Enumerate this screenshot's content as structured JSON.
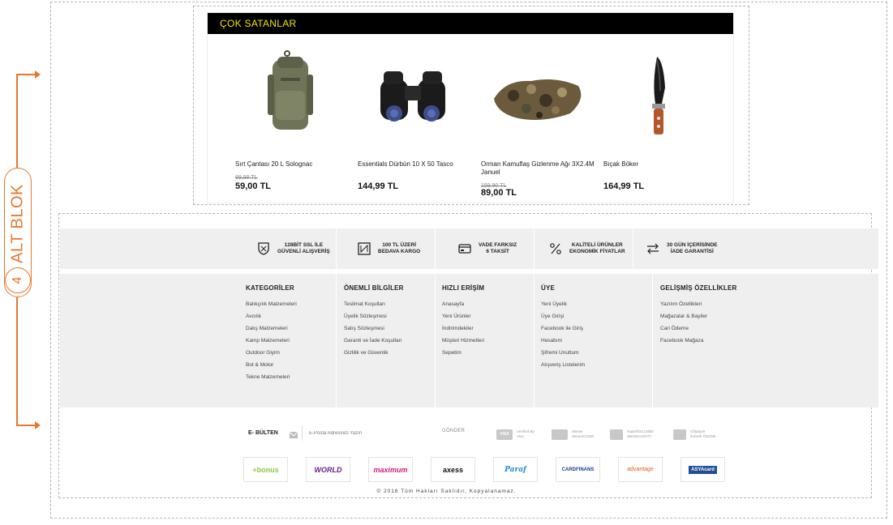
{
  "annotation": {
    "label": "ALT BLOK",
    "number": "4",
    "color": "#e8772e"
  },
  "best_sellers": {
    "title": "ÇOK SATANLAR",
    "products": [
      {
        "name": "Sırt Çantası 20 L Solognac",
        "old_price": "89,99 TL",
        "price": "59,00 TL",
        "icon": "backpack-icon"
      },
      {
        "name": "Essentials Dürbün 10 X 50 Tasco",
        "old_price": "",
        "price": "144,99 TL",
        "icon": "binoculars-icon"
      },
      {
        "name": "Orman Kamuflaş Gizlenme Ağı 3X2.4M Januel",
        "old_price": "159,90 TL",
        "price": "89,00 TL",
        "icon": "camouflage-net-icon"
      },
      {
        "name": "Bıçak Böker",
        "old_price": "",
        "price": "164,99 TL",
        "icon": "knife-icon"
      }
    ]
  },
  "features": [
    {
      "line1": "128BİT SSL İLE",
      "line2": "GÜVENLİ ALIŞVERİŞ",
      "icon": "shield-icon"
    },
    {
      "line1": "100 TL ÜZERİ",
      "line2": "BEDAVA KARGO",
      "icon": "box-icon"
    },
    {
      "line1": "VADE FARKSIZ",
      "line2": "6 TAKSİT",
      "icon": "credit-card-icon"
    },
    {
      "line1": "KALİTELİ ÜRÜNLER",
      "line2": "EKONOMİK FİYATLAR",
      "icon": "percent-icon"
    },
    {
      "line1": "30 GÜN İÇERİSİNDE",
      "line2": "İADE GARANTİSİ",
      "icon": "return-arrows-icon"
    }
  ],
  "footer_columns": [
    {
      "title": "KATEGORİLER",
      "items": [
        "Balıkçılık Malzemeleri",
        "Avcılık",
        "Dalış Malzemeleri",
        "Kamp Malzemeleri",
        "Outdoor Giyim",
        "Bot & Motor",
        "Tekne Malzemeleri"
      ]
    },
    {
      "title": "ÖNEMLİ BİLGİLER",
      "items": [
        "Teslimat Koşulları",
        "Üyelik Sözleşmesi",
        "Satış Sözleşmesi",
        "Garanti ve İade Koşulları",
        "Gizlilik ve Güvenlik"
      ]
    },
    {
      "title": "HIZLI ERİŞİM",
      "items": [
        "Anasayfa",
        "Yeni Ürünler",
        "İndirimdekiler",
        "Müşteri Hizmetleri",
        "Sepetim"
      ]
    },
    {
      "title": "ÜYE",
      "items": [
        "Yeni Üyelik",
        "Üye Girişi",
        "Facebook ile Giriş",
        "Hesabım",
        "Şifremi Unuttum",
        "Alışveriş Listelerim"
      ]
    },
    {
      "title": "GELİŞMİŞ ÖZELLİKLER",
      "items": [
        "Yazılım Özellikleri",
        "Mağazalar & Bayiler",
        "Cari Ödeme",
        "Facebook Mağaza"
      ]
    }
  ],
  "newsletter": {
    "label": "E- BÜLTEN",
    "placeholder": "E-Posta Adresinizi Yazın",
    "button": "GÖNDER"
  },
  "security_badges": [
    {
      "line1": "Verified By",
      "line2": "Visa",
      "icon_text": "VISA"
    },
    {
      "line1": "Master",
      "line2": "SecureCODE",
      "icon_text": ""
    },
    {
      "line1": "RapidSSL128bit",
      "line2": "SiteSECURITY",
      "icon_text": ""
    },
    {
      "line1": "Chip&pin",
      "line2": "lmzanlı ÖDEMe",
      "icon_text": ""
    }
  ],
  "banks": [
    {
      "label": "+bonus",
      "color": "#8dc63f"
    },
    {
      "label": "WORLD",
      "color": "#6a1b8a"
    },
    {
      "label": "maximum",
      "color": "#d6177c"
    },
    {
      "label": "axess",
      "color": "#111111"
    },
    {
      "label": "Paraf",
      "color": "#1e88c8"
    },
    {
      "label": "CARDFINANS",
      "color": "#1a3a8a"
    },
    {
      "label": "advantage",
      "color": "#e85a1b"
    },
    {
      "label": "ASYAcard",
      "color": "#1f4e96"
    }
  ],
  "copyright": "© 2016  Tüm Hakları Saklıdır, Kopyalanamaz."
}
